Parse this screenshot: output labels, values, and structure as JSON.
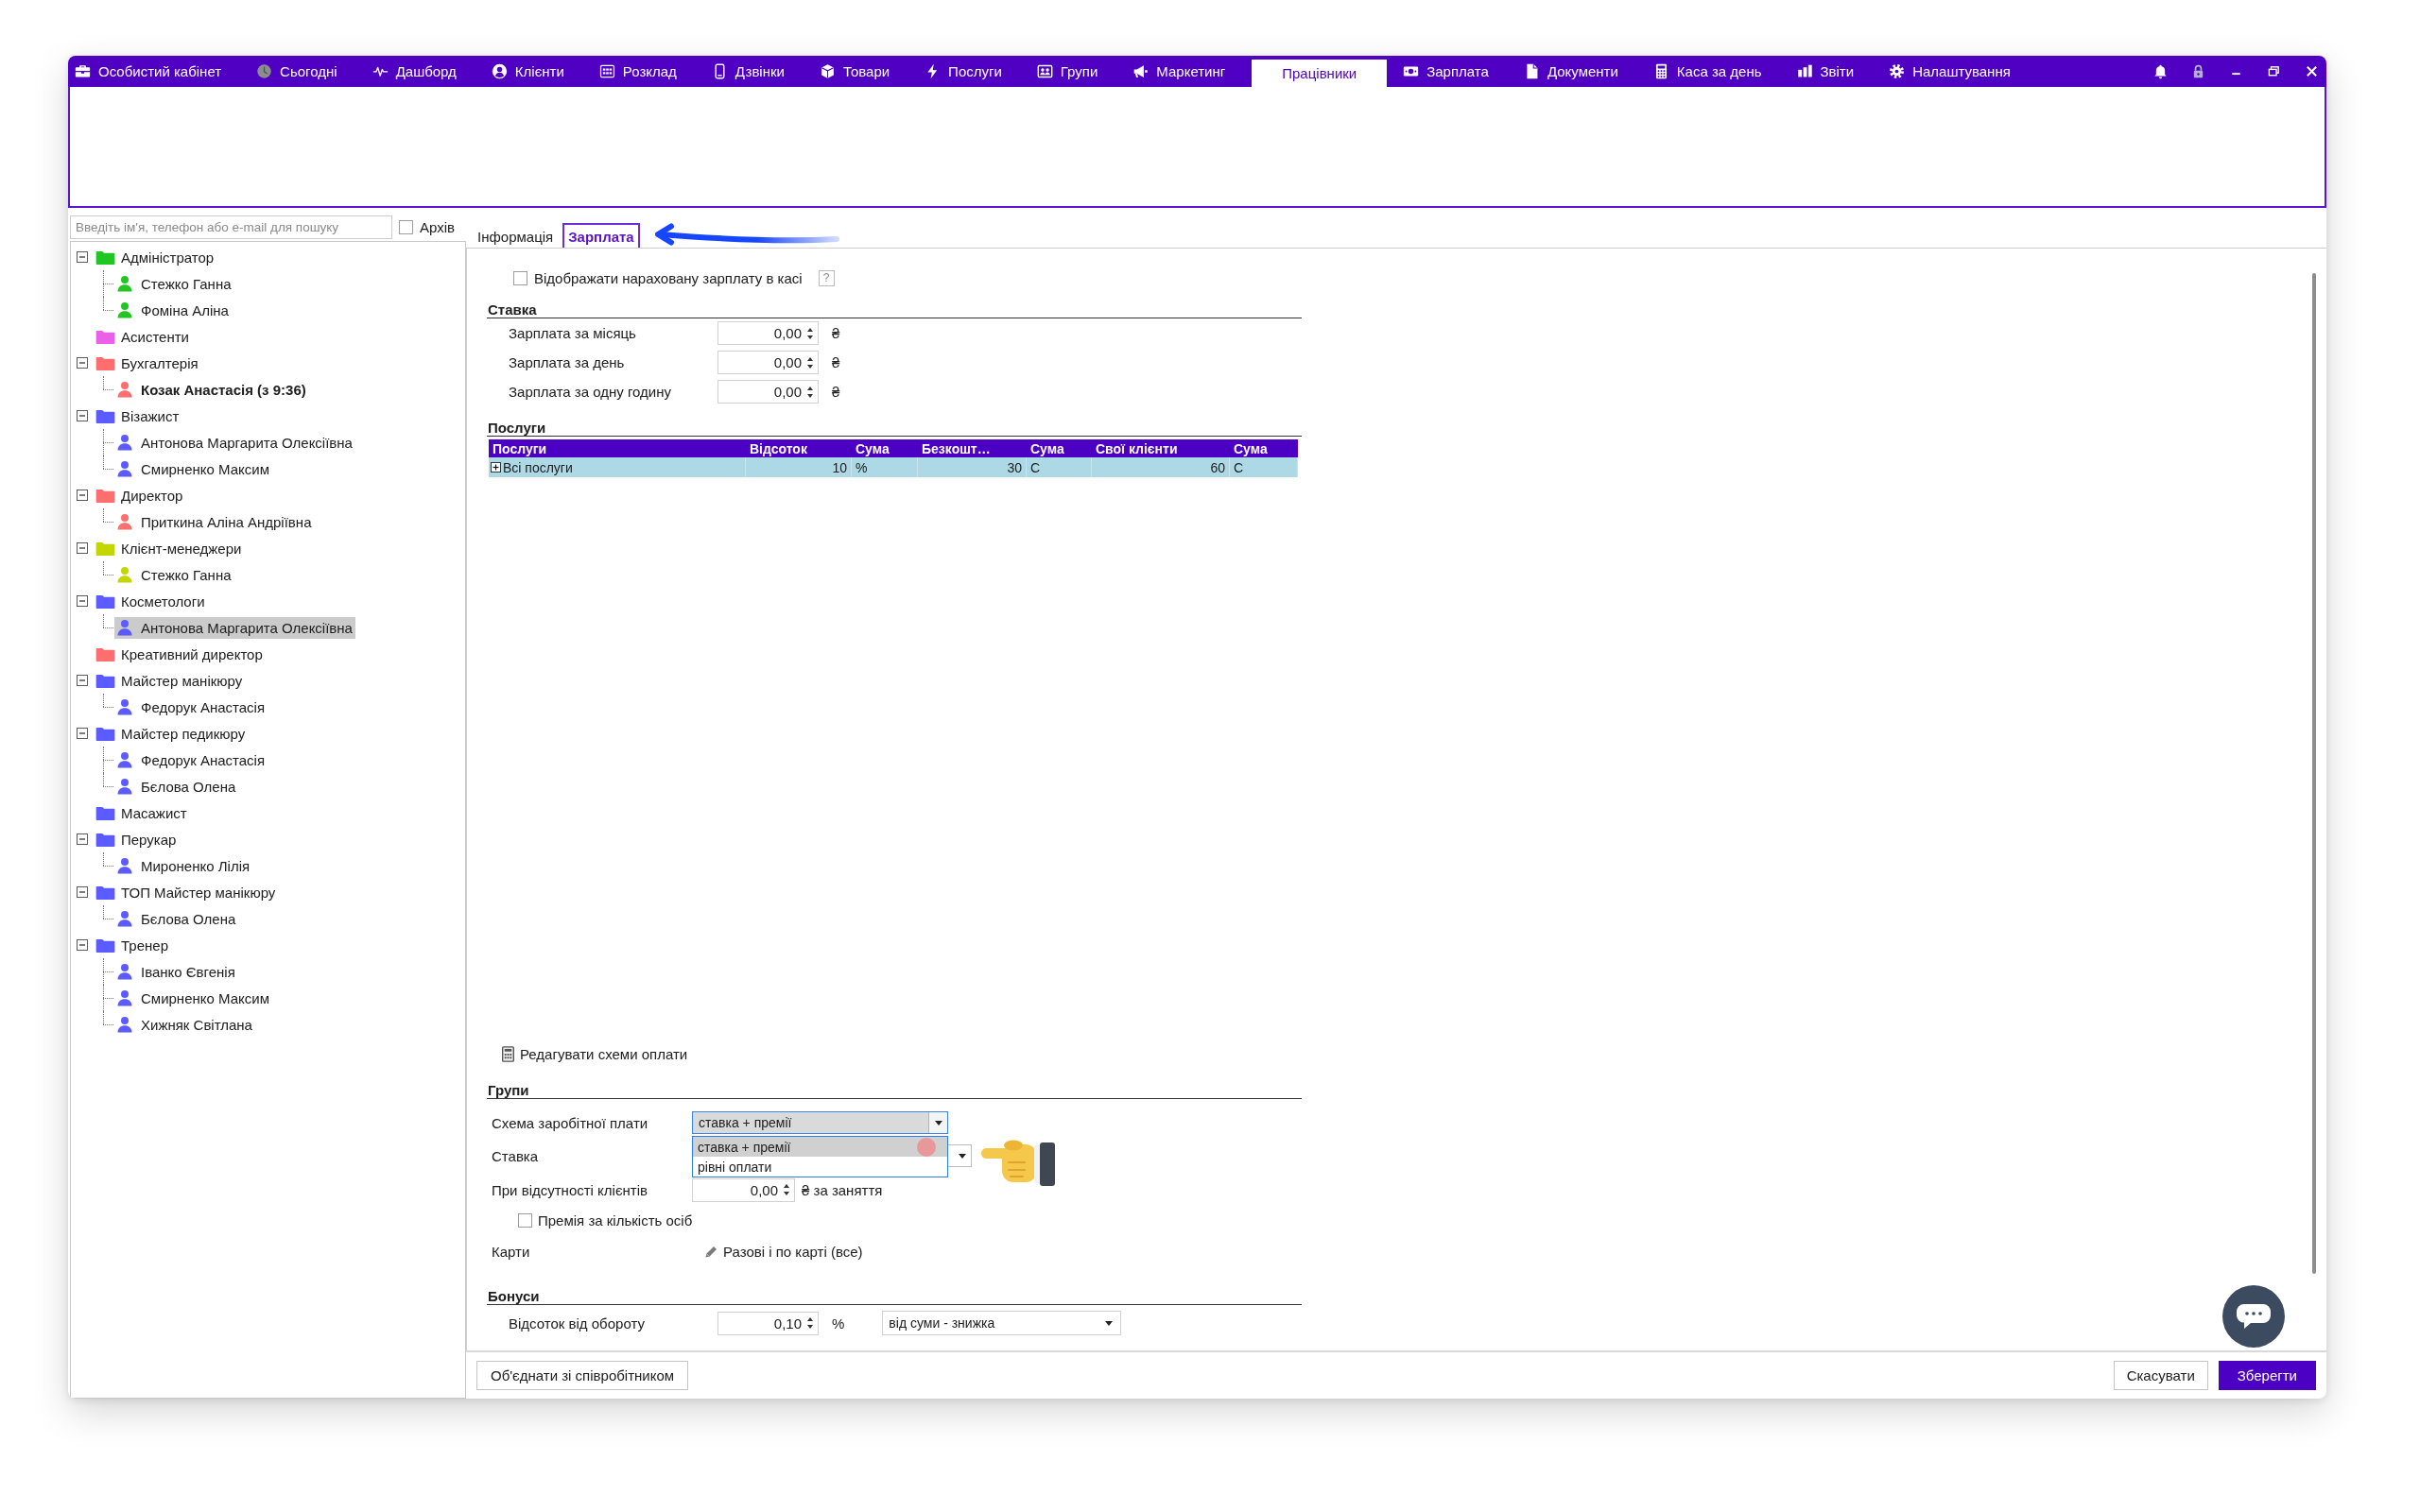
{
  "menu": [
    {
      "label": "Особистий кабінет",
      "selected": false
    },
    {
      "label": "Сьогодні",
      "selected": false
    },
    {
      "label": "Дашборд",
      "selected": false
    },
    {
      "label": "Клієнти",
      "selected": false
    },
    {
      "label": "Розклад",
      "selected": false
    },
    {
      "label": "Дзвінки",
      "selected": false
    },
    {
      "label": "Товари",
      "selected": false
    },
    {
      "label": "Послуги",
      "selected": false
    },
    {
      "label": "Групи",
      "selected": false
    },
    {
      "label": "Маркетинг",
      "selected": false
    },
    {
      "label": "Працівники",
      "selected": true
    },
    {
      "label": "Зарплата",
      "selected": false
    },
    {
      "label": "Документи",
      "selected": false
    },
    {
      "label": "Каса за день",
      "selected": false
    },
    {
      "label": "Звіти",
      "selected": false
    },
    {
      "label": "Налаштування",
      "selected": false
    }
  ],
  "search": {
    "placeholder": "Введіть ім'я, телефон або e-mail для пошуку"
  },
  "archive": {
    "label": "Архів",
    "checked": false
  },
  "tree": [
    {
      "label": "Адміністратор",
      "color": "#22c622",
      "expanded": true,
      "selected": false,
      "children": [
        {
          "label": "Стежко Ганна",
          "selected": false,
          "bold": false
        },
        {
          "label": "Фоміна Аліна",
          "selected": false,
          "bold": false
        }
      ]
    },
    {
      "label": "Асистенти",
      "color": "#ea60e8",
      "selected": false
    },
    {
      "label": "Бухгалтерія",
      "color": "#fd6e6e",
      "expanded": true,
      "selected": false,
      "children": [
        {
          "label": "Козак Анастасія (з 9:36)",
          "selected": false,
          "bold": true
        }
      ]
    },
    {
      "label": "Візажист",
      "color": "#5b5bff",
      "expanded": true,
      "selected": false,
      "children": [
        {
          "label": "Антонова Маргарита Олексіївна",
          "selected": false,
          "bold": false
        },
        {
          "label": "Смирненко Максим",
          "selected": false,
          "bold": false
        }
      ]
    },
    {
      "label": "Директор",
      "color": "#fd6e6e",
      "expanded": true,
      "selected": false,
      "children": [
        {
          "label": "Приткина Аліна Андріївна",
          "selected": false,
          "bold": false
        }
      ]
    },
    {
      "label": "Клієнт-менеджери",
      "color": "#c3d600",
      "expanded": true,
      "selected": false,
      "children": [
        {
          "label": "Стежко Ганна",
          "selected": false,
          "bold": false
        }
      ]
    },
    {
      "label": "Косметологи",
      "color": "#5b5bff",
      "expanded": true,
      "selected": false,
      "children": [
        {
          "label": "Антонова Маргарита Олексіївна",
          "selected": true,
          "bold": false
        }
      ]
    },
    {
      "label": "Креативний директор",
      "color": "#fd6e6e",
      "selected": false
    },
    {
      "label": "Майстер манікюру",
      "color": "#5b5bff",
      "expanded": true,
      "selected": false,
      "children": [
        {
          "label": "Федорук Анастасія",
          "selected": false,
          "bold": false
        }
      ]
    },
    {
      "label": "Майстер педикюру",
      "color": "#5b5bff",
      "expanded": true,
      "selected": false,
      "children": [
        {
          "label": "Федорук Анастасія",
          "selected": false,
          "bold": false
        },
        {
          "label": "Бєлова Олена",
          "selected": false,
          "bold": false
        }
      ]
    },
    {
      "label": "Масажист",
      "color": "#5b5bff",
      "selected": false
    },
    {
      "label": "Перукар",
      "color": "#5b5bff",
      "expanded": true,
      "selected": false,
      "children": [
        {
          "label": "Мироненко Лілія",
          "selected": false,
          "bold": false
        }
      ]
    },
    {
      "label": "ТОП Майстер манікюру",
      "color": "#5b5bff",
      "expanded": true,
      "selected": false,
      "children": [
        {
          "label": "Бєлова Олена",
          "selected": false,
          "bold": false
        }
      ]
    },
    {
      "label": "Тренер",
      "color": "#5b5bff",
      "expanded": true,
      "selected": false,
      "children": [
        {
          "label": "Іванко Євгенія",
          "selected": false,
          "bold": false
        },
        {
          "label": "Смирненко Максим",
          "selected": false,
          "bold": false
        },
        {
          "label": "Хижняк Світлана",
          "selected": false,
          "bold": false
        }
      ]
    }
  ],
  "tabs": [
    {
      "label": "Інформація",
      "selected": false
    },
    {
      "label": "Зарплата",
      "selected": true
    }
  ],
  "salary_in_cash": {
    "label": "Відображати нараховану зарплату в касі",
    "checked": false,
    "help": "?"
  },
  "rate": {
    "title": "Ставка",
    "rows": [
      {
        "label": "Зарплата за місяць",
        "value": "0,00",
        "unit": "₴"
      },
      {
        "label": "Зарплата за день",
        "value": "0,00",
        "unit": "₴"
      },
      {
        "label": "Зарплата за одну годину",
        "value": "0,00",
        "unit": "₴"
      }
    ]
  },
  "services": {
    "title": "Послуги",
    "columns": [
      "Послуги",
      "Відсоток",
      "Сума",
      "Безкошт…",
      "Сума",
      "Свої клієнти",
      "Сума"
    ],
    "rows": [
      {
        "cells": [
          "Всі послуги",
          "10",
          "%",
          "30",
          "C",
          "60",
          "C"
        ],
        "expanded": false,
        "selected": true
      }
    ]
  },
  "edit_schemes": {
    "label": "Редагувати схеми оплати"
  },
  "groups": {
    "title": "Групи",
    "scheme": {
      "label": "Схема заробітної плати",
      "value": "ставка + премії",
      "expanded": true,
      "options": [
        {
          "label": "ставка + премії",
          "selected": true
        },
        {
          "label": "рівні оплати",
          "selected": false
        }
      ]
    },
    "rate": {
      "label": "Ставка"
    },
    "no_clients": {
      "label": "При відсутності клієнтів",
      "value": "0,00",
      "unit": "₴ за заняття"
    },
    "per_person_bonus": {
      "label": "Премія за кількість осіб",
      "checked": false
    },
    "cards": {
      "label": "Карти",
      "value": "Разові і по карті (все)"
    }
  },
  "bonuses": {
    "title": "Бонуси",
    "turnover": {
      "label": "Відсоток від обороту",
      "value": "0,10",
      "unit": "%",
      "mode": "від суми - знижка"
    }
  },
  "footer": {
    "merge": "Об'єднати зі співробітником",
    "cancel": "Скасувати",
    "save": "Зберегти"
  }
}
